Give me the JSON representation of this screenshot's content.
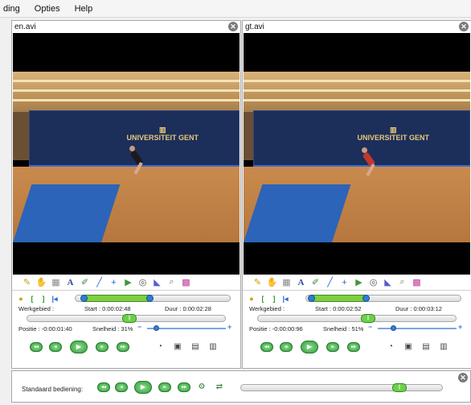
{
  "menu": {
    "item1": "ding",
    "item2": "Opties",
    "item3": "Help"
  },
  "left": {
    "title": "en.avi",
    "werkgebied": "Werkgebied :",
    "start": "Start : 0:00:02:48",
    "duur": "Duur : 0:00:02:28",
    "positie": "Positie : -0:00:01:40",
    "snelheid": "Snelheid : 31%",
    "work_fraction": 0.45,
    "position_fraction": 0.42,
    "speed_fraction": 0.28
  },
  "right": {
    "title": "gt.avi",
    "werkgebied": "Werkgebied :",
    "start": "Start : 0:00:02:52",
    "duur": "Duur : 0:00:03:12",
    "positie": "Positie : -0:00:00:96",
    "snelheid": "Snelheid : 51%",
    "work_fraction": 0.4,
    "position_fraction": 0.48,
    "speed_fraction": 0.35
  },
  "banner_text": "UNIVERSITEIT GENT",
  "standard": {
    "label": "Standaard bediening:"
  },
  "icons": {
    "close": "close-icon",
    "pointer": "pointer-icon",
    "hand": "hand-icon",
    "text": "text-icon",
    "pen": "pen-icon",
    "line": "line-icon",
    "point": "point-icon",
    "angle": "angle-icon",
    "circle": "circle-icon",
    "polygon": "polygon-icon",
    "zoom": "zoom-icon",
    "grid": "grid-icon"
  }
}
